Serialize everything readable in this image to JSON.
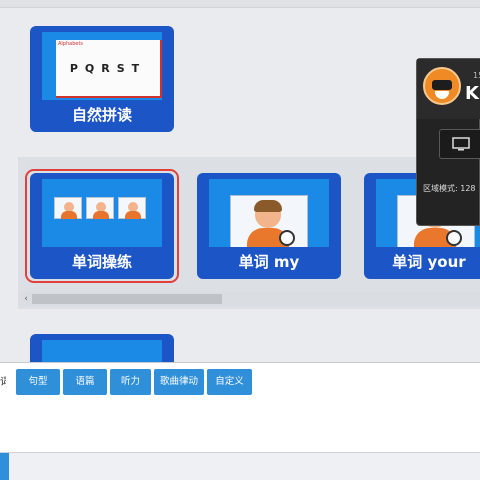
{
  "cards": {
    "pinyin": {
      "label": "自然拼读",
      "slide_caption": "Alphabets",
      "slide_letters": "PQRST"
    },
    "word_drill": {
      "label": "单词操练"
    },
    "word_my": {
      "label": "单词 my"
    },
    "word_your": {
      "label": "单词 your"
    }
  },
  "overlay": {
    "number": "15",
    "brand": "K",
    "mode_text": "区域模式: 128"
  },
  "toolbar": {
    "partial_label": "词",
    "buttons": [
      "句型",
      "语篇",
      "听力",
      "歌曲律动",
      "自定义"
    ]
  },
  "colors": {
    "card_frame": "#1c55c6",
    "card_screen": "#1a8ae6",
    "selection": "#e0413c",
    "toolbar_button": "#2f8fd9"
  }
}
